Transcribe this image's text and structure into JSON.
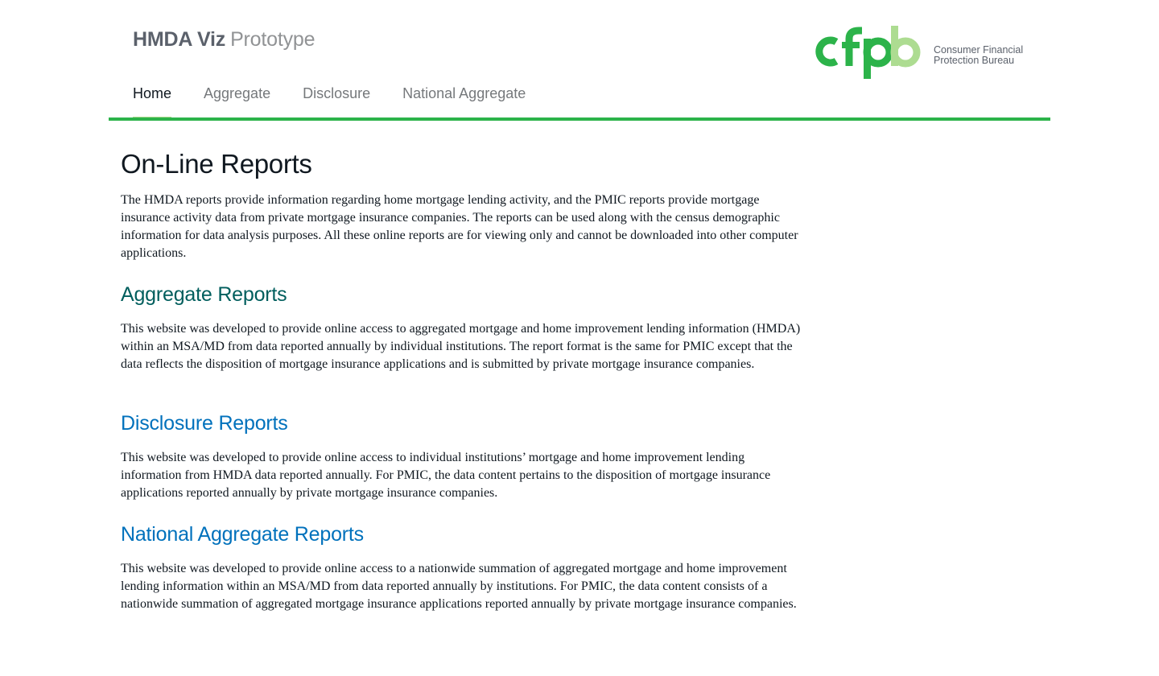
{
  "header": {
    "title_strong": "HMDA Viz",
    "title_light": "Prototype",
    "logo": {
      "wordmark": "cfpb",
      "line1": "Consumer Financial",
      "line2": "Protection Bureau",
      "colors": {
        "dark_green": "#2cb34a",
        "light_green": "#addc91"
      }
    }
  },
  "nav": {
    "items": [
      {
        "label": "Home",
        "active": true
      },
      {
        "label": "Aggregate",
        "active": false
      },
      {
        "label": "Disclosure",
        "active": false
      },
      {
        "label": "National Aggregate",
        "active": false
      }
    ],
    "rule_color": "#2cb34a",
    "active_indicator_color": "#addc91"
  },
  "main": {
    "title": "On-Line Reports",
    "intro": "The HMDA reports provide information regarding home mortgage lending activity, and the PMIC reports provide mortgage insurance activity data from private mortgage insurance companies. The reports can be used along with the census demographic information for data analysis purposes. All these online reports are for viewing only and cannot be downloaded into other computer applications.",
    "sections": [
      {
        "heading": "Aggregate Reports",
        "body": "This website was developed to provide online access to aggregated mortgage and home improvement lending information (HMDA) within an MSA/MD from data reported annually by individual institutions. The report format is the same for PMIC except that the data reflects the disposition of mortgage insurance applications and is submitted by private mortgage insurance companies.",
        "link_color": "#005e5d"
      },
      {
        "heading": "Disclosure Reports",
        "body": "This website was developed to provide online access to individual institutions’ mortgage and home improvement lending information from HMDA data reported annually. For PMIC, the data content pertains to the disposition of mortgage insurance applications reported annually by private mortgage insurance companies.",
        "link_color": "#0071bc"
      },
      {
        "heading": "National Aggregate Reports",
        "body": "This website was developed to provide online access to a nationwide summation of aggregated mortgage and home improvement lending information within an MSA/MD from data reported annually by institutions. For PMIC, the data content consists of a nationwide summation of aggregated mortgage insurance applications reported annually by private mortgage insurance companies.",
        "link_color": "#0071bc"
      }
    ]
  }
}
